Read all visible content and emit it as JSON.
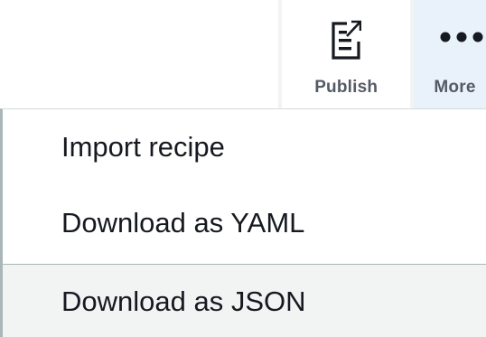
{
  "toolbar": {
    "publish": {
      "label": "Publish",
      "icon": "publish-icon"
    },
    "more": {
      "label": "More",
      "icon": "more-dots-icon"
    }
  },
  "menu": {
    "items": [
      {
        "label": "Import recipe"
      },
      {
        "label": "Download as YAML"
      },
      {
        "label": "Download as JSON"
      }
    ]
  },
  "colors": {
    "text": "#16191f",
    "toolbar_label": "#545b64",
    "more_active_bg": "#e9f2fb",
    "hover_bg": "#f2f3f3",
    "border": "#aab7b8"
  }
}
